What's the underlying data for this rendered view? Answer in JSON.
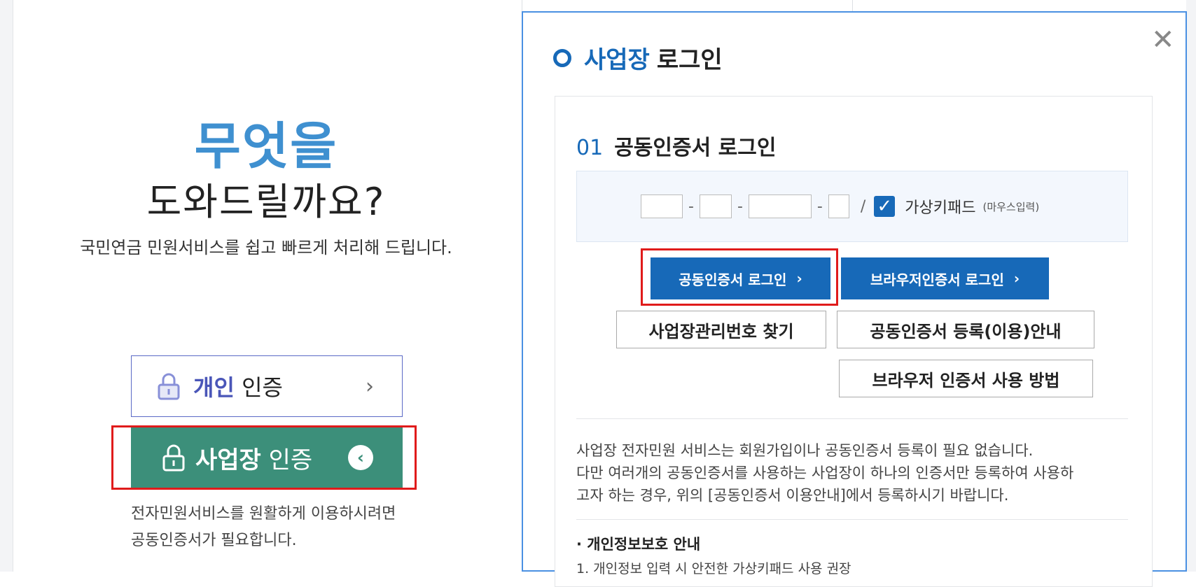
{
  "left": {
    "hero_title": "무엇을",
    "hero_subtitle": "도와드릴까요?",
    "hero_desc": "국민연금 민원서비스를 쉽고 빠르게 처리해 드립니다.",
    "personal_bold": "개인",
    "personal_rest": " 인증",
    "business_bold": "사업장",
    "business_rest": " 인증",
    "note_line1": "전자민원서비스를 원활하게 이용하시려면",
    "note_line2": "공동인증서가 필요합니다."
  },
  "modal": {
    "title_accent": "사업장",
    "title_rest": "로그인",
    "close_symbol": "✕",
    "step_num": "01",
    "step_title": "공동인증서 로그인",
    "sep": "-",
    "slash": "/",
    "keypad_label": "가상키패드",
    "keypad_small": "(마우스입력)",
    "btn_cert_login": "공동인증서 로그인",
    "btn_browser_login": "브라우저인증서 로그인",
    "btn_find": "사업장관리번호 찾기",
    "btn_guide": "공동인증서 등록(이용)안내",
    "btn_browser_howto": "브라우저 인증서 사용 방법",
    "info_line1": "사업장 전자민원 서비스는 회원가입이나 공동인증서 등록이 필요 없습니다.",
    "info_line2": "다만 여러개의 공동인증서를 사용하는 사업장이 하나의 인증서만 등록하여 사용하",
    "info_line3": "고자 하는 경우, 위의 [공동인증서 이용안내]에서 등록하시기 바랍니다.",
    "privacy_title": "· 개인정보보호 안내",
    "privacy_line1": "1. 개인정보 입력 시 안전한 가상키패드 사용 권장"
  },
  "colors": {
    "accent_blue": "#1769b8",
    "hero_blue": "#3f90d0",
    "business_green": "#3c8f7a",
    "highlight_red": "#e01b1b"
  }
}
